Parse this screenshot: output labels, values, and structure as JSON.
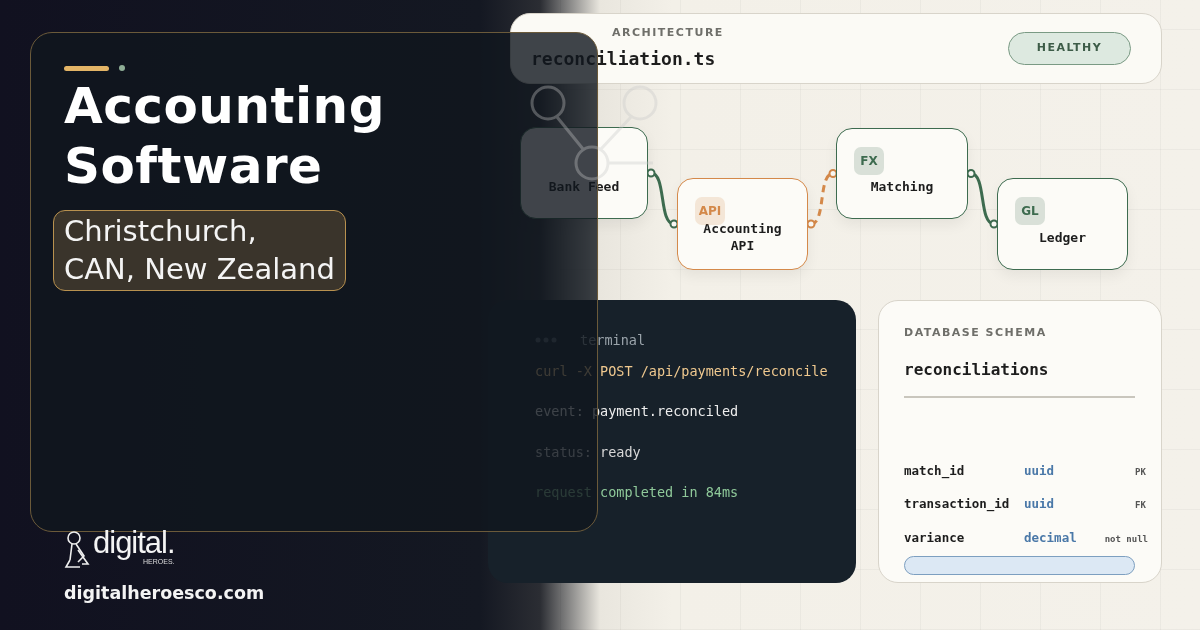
{
  "hero": {
    "title_lines": [
      "Accounting",
      "Software"
    ],
    "location_lines": [
      "Christchurch,",
      "CAN, New Zealand"
    ]
  },
  "brand": {
    "logo_word": "digital.",
    "logo_sub": "HEROES.",
    "website": "digitalheroesco.com"
  },
  "architecture": {
    "label": "ARCHITECTURE",
    "file": "reconciliation.ts",
    "status": "HEALTHY"
  },
  "diagram": {
    "nodes": [
      {
        "label": "Bank Feed",
        "color": "#3d6b4f"
      },
      {
        "tag": "API",
        "label": "Accounting API",
        "color": "#d4894a"
      },
      {
        "tag": "FX",
        "label": "Matching",
        "color": "#3d6b4f"
      },
      {
        "tag": "GL",
        "label": "Ledger",
        "color": "#3d6b4f"
      }
    ],
    "edges": [
      {
        "dashed": false,
        "color": "#3d6b4f"
      },
      {
        "dashed": true,
        "color": "#d4894a"
      },
      {
        "dashed": false,
        "color": "#3d6b4f"
      }
    ]
  },
  "terminal": {
    "title": "terminal",
    "lines": [
      {
        "text": "curl -X POST /api/payments/reconcile",
        "color": "#f0c98f"
      },
      {
        "text": "event: payment.reconciled",
        "color": "#eeeeee"
      },
      {
        "text": "status: ready",
        "color": "#d8d8d8"
      },
      {
        "text": "request completed in 84ms",
        "color": "#8fc99a"
      }
    ]
  },
  "schema": {
    "label": "DATABASE SCHEMA",
    "table": "reconciliations",
    "fields": [
      {
        "name": "match_id",
        "type": "uuid",
        "flag": "PK"
      },
      {
        "name": "transaction_id",
        "type": "uuid",
        "flag": "FK"
      },
      {
        "name": "variance",
        "type": "decimal",
        "flag": "not null"
      }
    ]
  }
}
